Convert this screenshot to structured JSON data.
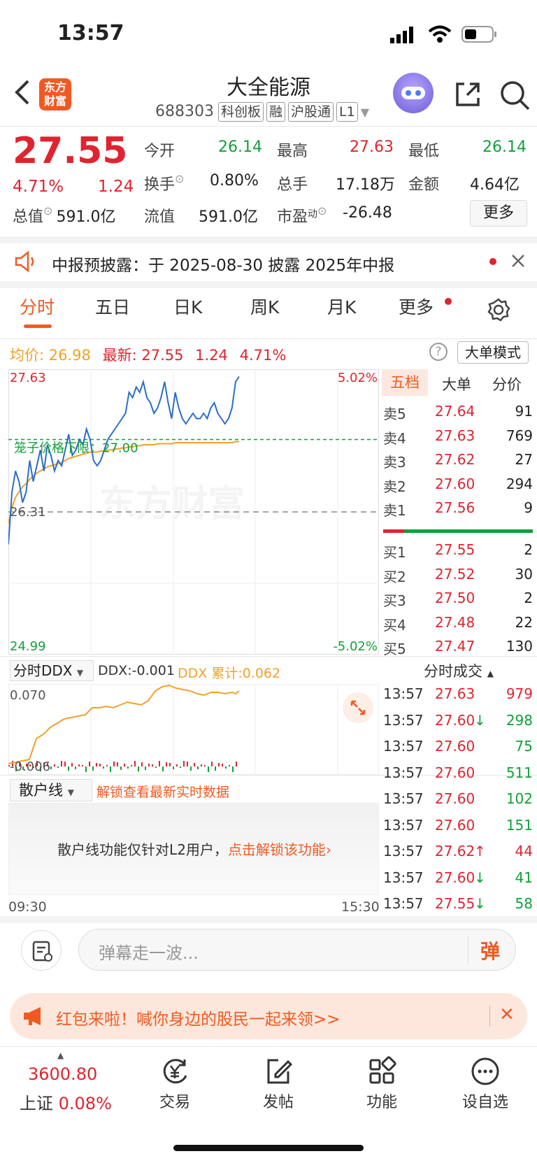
{
  "status_bar": {
    "time": "13:57"
  },
  "header": {
    "logo_text": "东方财富",
    "title": "大全能源",
    "code": "688303",
    "tags": [
      "科创板",
      "融",
      "沪股通",
      "L1"
    ]
  },
  "quote": {
    "price": "27.55",
    "change_pct": "4.71%",
    "change": "1.24",
    "labels": {
      "open": "今开",
      "high": "最高",
      "low": "最低",
      "turnover": "换手",
      "volume": "总手",
      "amount": "金额",
      "mktcap": "总值",
      "float_cap": "流值",
      "pe": "市盈",
      "pe_sup": "动"
    },
    "open": "26.14",
    "high": "27.63",
    "low": "26.14",
    "turnover": "0.80%",
    "volume": "17.18万",
    "amount": "4.64亿",
    "mktcap": "591.0亿",
    "float_cap": "591.0亿",
    "pe": "-26.48",
    "more_button": "更多"
  },
  "notice": {
    "text": "中报预披露：于 2025-08-30 披露 2025年中报"
  },
  "tabs": [
    "分时",
    "五日",
    "日K",
    "周K",
    "月K",
    "更多"
  ],
  "chart_header": {
    "avg_label": "均价:",
    "avg_value": "26.98",
    "last_label": "最新:",
    "last_value": "27.55",
    "change": "1.24",
    "change_pct": "4.71%",
    "mode_button": "大单模式"
  },
  "chart_data": {
    "type": "line",
    "y_ticks_left": [
      "27.63",
      "26.31",
      "24.99"
    ],
    "y_ticks_right": [
      "5.02%",
      "-5.02%"
    ],
    "ylim": [
      24.99,
      27.63
    ],
    "prev_close": 26.31,
    "limit_line_label": "笼子价格下限：27.00",
    "limit_line_value": 27.0,
    "x_labels": [
      "09:30",
      "15:30"
    ],
    "watermark": "东方财富",
    "series": [
      {
        "name": "最新",
        "color": "#2a6ec8",
        "values": [
          26.0,
          26.5,
          26.7,
          26.6,
          26.4,
          26.5,
          26.8,
          26.6,
          26.75,
          26.9,
          26.7,
          26.95,
          26.85,
          26.7,
          26.8,
          26.75,
          26.9,
          27.05,
          26.85,
          26.9,
          27.0,
          26.95,
          27.1,
          27.0,
          26.8,
          26.75,
          26.8,
          26.9,
          27.0,
          27.05,
          27.1,
          27.15,
          27.2,
          27.25,
          27.45,
          27.4,
          27.5,
          27.45,
          27.55,
          27.4,
          27.35,
          27.25,
          27.3,
          27.4,
          27.55,
          27.35,
          27.2,
          27.45,
          27.3,
          27.2,
          27.15,
          27.2,
          27.25,
          27.2,
          27.2,
          27.25,
          27.2,
          27.3,
          27.35,
          27.25,
          27.2,
          27.15,
          27.2,
          27.3,
          27.55,
          27.6
        ]
      },
      {
        "name": "均价",
        "color": "#f0a22a",
        "values": [
          26.2,
          26.35,
          26.45,
          26.5,
          26.55,
          26.58,
          26.62,
          26.65,
          26.68,
          26.7,
          26.72,
          26.74,
          26.75,
          26.76,
          26.77,
          26.78,
          26.8,
          26.82,
          26.83,
          26.84,
          26.85,
          26.86,
          26.87,
          26.88,
          26.88,
          26.88,
          26.89,
          26.89,
          26.9,
          26.9,
          26.91,
          26.91,
          26.92,
          26.92,
          26.93,
          26.93,
          26.94,
          26.94,
          26.95,
          26.95,
          26.95,
          26.95,
          26.96,
          26.96,
          26.96,
          26.96,
          26.96,
          26.97,
          26.97,
          26.97,
          26.97,
          26.97,
          26.97,
          26.97,
          26.97,
          26.97,
          26.97,
          26.97,
          26.97,
          26.97,
          26.97,
          26.97,
          26.97,
          26.97,
          26.98,
          26.98
        ]
      }
    ]
  },
  "orderbook": {
    "tabs": [
      "五档",
      "大单",
      "分价"
    ],
    "asks": [
      {
        "label": "卖5",
        "price": "27.64",
        "qty": "91"
      },
      {
        "label": "卖4",
        "price": "27.63",
        "qty": "769"
      },
      {
        "label": "卖3",
        "price": "27.62",
        "qty": "27"
      },
      {
        "label": "卖2",
        "price": "27.60",
        "qty": "294"
      },
      {
        "label": "卖1",
        "price": "27.56",
        "qty": "9"
      }
    ],
    "bids": [
      {
        "label": "买1",
        "price": "27.55",
        "qty": "2"
      },
      {
        "label": "买2",
        "price": "27.52",
        "qty": "30"
      },
      {
        "label": "买3",
        "price": "27.50",
        "qty": "2"
      },
      {
        "label": "买4",
        "price": "27.48",
        "qty": "22"
      },
      {
        "label": "买5",
        "price": "27.47",
        "qty": "130"
      }
    ]
  },
  "ddx": {
    "selector": "分时DDX",
    "ddx_label": "DDX:-0.001",
    "cum_label": "DDX 累计:0.062",
    "y_top": "0.070",
    "y_bottom": "-0.006"
  },
  "retail": {
    "selector": "散户线",
    "unlock_text": "解锁查看最新实时数据",
    "message": "散户线功能仅针对L2用户，",
    "link": "点击解锁该功能"
  },
  "trades": {
    "title": "分时成交",
    "rows": [
      {
        "time": "13:57",
        "price": "27.63",
        "arrow": "",
        "qty": "979",
        "color": "red"
      },
      {
        "time": "13:57",
        "price": "27.60",
        "arrow": "↓",
        "qty": "298",
        "color": "green"
      },
      {
        "time": "13:57",
        "price": "27.60",
        "arrow": "",
        "qty": "75",
        "color": "green"
      },
      {
        "time": "13:57",
        "price": "27.60",
        "arrow": "",
        "qty": "511",
        "color": "green"
      },
      {
        "time": "13:57",
        "price": "27.60",
        "arrow": "",
        "qty": "102",
        "color": "green"
      },
      {
        "time": "13:57",
        "price": "27.60",
        "arrow": "",
        "qty": "151",
        "color": "green"
      },
      {
        "time": "13:57",
        "price": "27.62",
        "arrow": "↑",
        "qty": "44",
        "color": "red"
      },
      {
        "time": "13:57",
        "price": "27.60",
        "arrow": "↓",
        "qty": "41",
        "color": "green"
      },
      {
        "time": "13:57",
        "price": "27.55",
        "arrow": "↓",
        "qty": "58",
        "color": "green"
      }
    ]
  },
  "comment": {
    "placeholder": "弹幕走一波...",
    "send": "弹"
  },
  "promo": {
    "text": "红包来啦！喊你身边的股民一起来领>>"
  },
  "bottom_nav": {
    "index_value": "3600.80",
    "index_name": "上证",
    "index_change": "0.08%",
    "items": [
      "交易",
      "发帖",
      "功能",
      "设自选"
    ]
  },
  "colors": {
    "up": "#e0242f",
    "down": "#12a03a",
    "accent": "#f05a22",
    "avg": "#f0a22a",
    "price_line": "#2a6ec8"
  }
}
